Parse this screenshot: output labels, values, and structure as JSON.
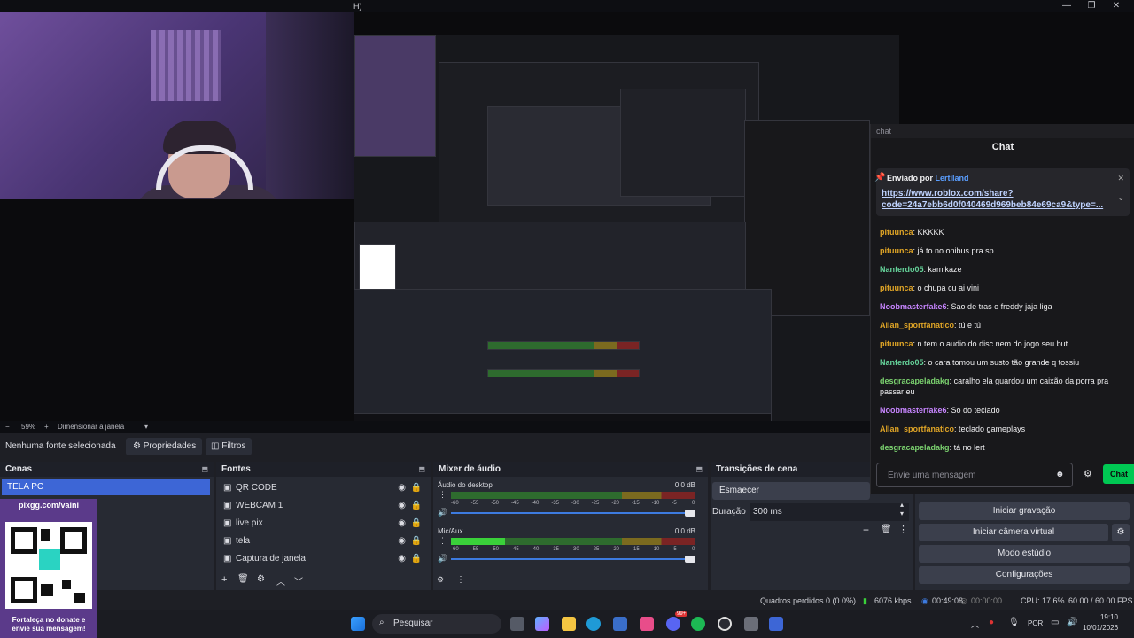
{
  "title_partial": "H)",
  "window_controls": {
    "minimize": "—",
    "maximize": "❐",
    "close": "✕"
  },
  "chat": {
    "tab": "chat",
    "title": "Chat",
    "pinned_label": "Enviado por",
    "pinned_user": "Lertiland",
    "pinned_link": "https://www.roblox.com/share?code=24a7ebb6d0f040469d969beb84e69ca9&type=...",
    "messages": [
      {
        "user": "pituunca",
        "color": "#e0a526",
        "text": "KKKKK"
      },
      {
        "user": "pituunca",
        "color": "#e0a526",
        "text": "já to no onibus pra sp"
      },
      {
        "user": "Nanferdo05",
        "color": "#65d39a",
        "text": "kamikaze"
      },
      {
        "user": "pituunca",
        "color": "#e0a526",
        "text": "o chupa cu ai vini"
      },
      {
        "user": "Noobmasterfake6",
        "color": "#c785ff",
        "text": "Sao de tras o freddy jaja liga"
      },
      {
        "user": "Allan_sportfanatico",
        "color": "#e0a526",
        "text": "tú e tú"
      },
      {
        "user": "pituunca",
        "color": "#e0a526",
        "text": "n tem o audio do disc nem do jogo seu but"
      },
      {
        "user": "Nanferdo05",
        "color": "#65d39a",
        "text": "o cara tomou um susto tão grande q tossiu"
      },
      {
        "user": "desgracapeladakg",
        "color": "#7bd26f",
        "text": "caralho ela guardou um caixão da porra pra passar eu"
      },
      {
        "user": "Noobmasterfake6",
        "color": "#c785ff",
        "text": "So do teclado"
      },
      {
        "user": "Allan_sportfanatico",
        "color": "#e0a526",
        "text": "teclado gameplays"
      },
      {
        "user": "desgracapeladakg",
        "color": "#7bd26f",
        "text": "tá no lert"
      }
    ],
    "input_placeholder": "Envie uma mensagem",
    "send_label": "Chat"
  },
  "zoom": {
    "value": "59%",
    "mode": "Dimensionar à janela"
  },
  "props_bar": {
    "selection": "Nenhuma fonte selecionada",
    "properties": "Propriedades",
    "filters": "Filtros"
  },
  "scenes": {
    "title": "Cenas",
    "items": [
      "TELA PC"
    ],
    "overlay_url": "pixgg.com/vaini",
    "overlay_text": "Fortaleça no donate e envie sua mensagem!"
  },
  "sources": {
    "title": "Fontes",
    "items": [
      "QR CODE",
      "WEBCAM 1",
      "live pix",
      "tela",
      "Captura de janela"
    ]
  },
  "mixer": {
    "title": "Mixer de áudio",
    "channels": [
      {
        "name": "Áudio do desktop",
        "db": "0.0 dB",
        "level": 0.0
      },
      {
        "name": "Mic/Aux",
        "db": "0.0 dB",
        "level": 0.22
      }
    ],
    "ticks": [
      "-60",
      "-55",
      "-50",
      "-45",
      "-40",
      "-35",
      "-30",
      "-25",
      "-20",
      "-15",
      "-10",
      "-5",
      "0"
    ]
  },
  "transitions": {
    "title": "Transições de cena",
    "type": "Esmaecer",
    "duration_label": "Duração",
    "duration": "300 ms"
  },
  "controls": {
    "record": "Iniciar gravação",
    "virtual_cam": "Iniciar câmera virtual",
    "studio": "Modo estúdio",
    "settings": "Configurações"
  },
  "status": {
    "dropped": "Quadros perdidos 0 (0.0%)",
    "bitrate": "6076 kbps",
    "live_time": "00:49:08",
    "rec_time": "00:00:00",
    "cpu": "CPU: 17.6%",
    "fps": "60.00 / 60.00 FPS"
  },
  "taskbar": {
    "search": "Pesquisar",
    "lang": "POR",
    "time": "19:10",
    "date": "10/01/2026",
    "badge": "99+"
  }
}
